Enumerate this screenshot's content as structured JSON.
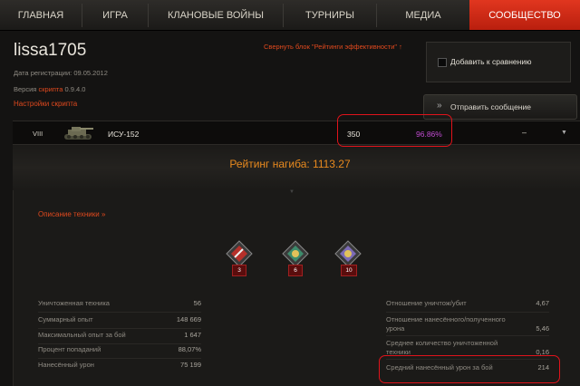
{
  "nav": {
    "items": [
      "ГЛАВНАЯ",
      "ИГРА",
      "КЛАНОВЫЕ ВОЙНЫ",
      "ТУРНИРЫ",
      "МЕДИА",
      "СООБЩЕСТВО"
    ],
    "active_index": 5,
    "active_color": "#d42b15"
  },
  "profile": {
    "username": "lissa1705",
    "registration": "Дата регистрации: 09.05.2012",
    "version_prefix": "Версия",
    "version_link": "скрипта",
    "version_number": "0.9.4.0",
    "settings_link": "Настройки скрипта",
    "collapse_link": "Свернуть блок \"Рейтинги эффективности\" ↑"
  },
  "actions": {
    "compare_label": "Добавить к сравнению",
    "message_label": "Отправить сообщение"
  },
  "tank_row": {
    "tier": "VIII",
    "name": "ИСУ-152",
    "battles": "350",
    "winrate": "96.86%",
    "extra": "–",
    "dropdown_icon": "caret-down-icon"
  },
  "rating": {
    "text": "Рейтинг нагиба: 1113.27"
  },
  "vehicle_desc_link": "Описание техники »",
  "achievements": [
    {
      "icon": "medal-red-icon",
      "count": "3"
    },
    {
      "icon": "medal-green-icon",
      "count": "6"
    },
    {
      "icon": "medal-purple-icon",
      "count": "10"
    }
  ],
  "stats_left": [
    {
      "label": "Уничтоженная техника",
      "value": "56"
    },
    {
      "label": "Суммарный опыт",
      "value": "148 669"
    },
    {
      "label": "Максимальный опыт за бой",
      "value": "1 647"
    },
    {
      "label": "Процент попаданий",
      "value": "88,07%"
    },
    {
      "label": "Нанесённый урон",
      "value": "75 199"
    }
  ],
  "stats_right": [
    {
      "label": "Отношение уничтож/убит",
      "value": "4,67"
    },
    {
      "label": "Отношение нанесённого/полученного урона",
      "value": "5,46"
    },
    {
      "label": "Среднее количество уничтоженной техники",
      "value": "0,16"
    },
    {
      "label": "Средний нанесённый урон за бой",
      "value": "214"
    }
  ]
}
